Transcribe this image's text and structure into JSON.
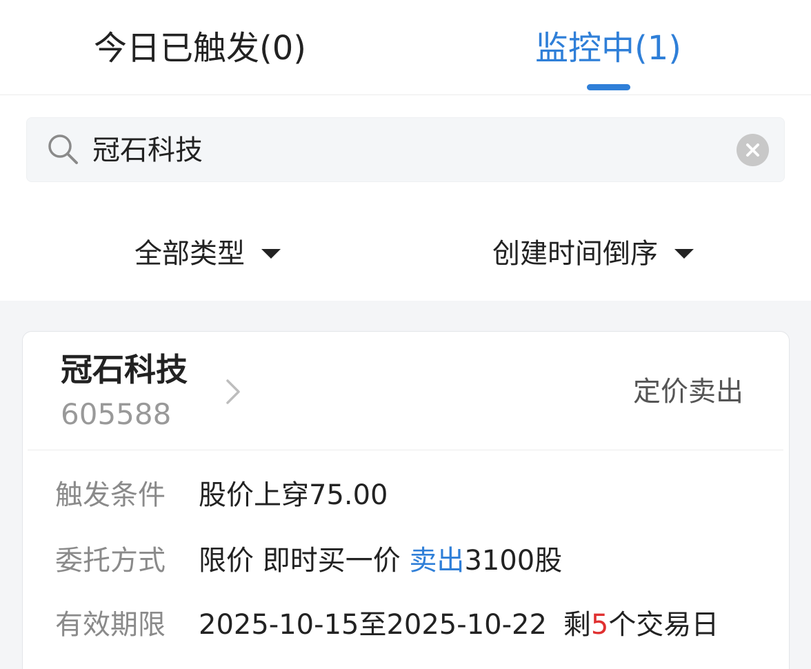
{
  "tabs": {
    "triggered_label": "今日已触发(0)",
    "monitoring_label": "监控中(1)"
  },
  "search": {
    "value": "冠石科技"
  },
  "filters": {
    "type_label": "全部类型",
    "sort_label": "创建时间倒序"
  },
  "card": {
    "stock_name": "冠石科技",
    "stock_code": "605588",
    "order_type": "定价卖出",
    "trigger": {
      "label": "触发条件",
      "value": "股价上穿75.00"
    },
    "entrust": {
      "label": "委托方式",
      "prefix": "限价 即时买一价 ",
      "action": "卖出",
      "quantity": "3100股"
    },
    "validity": {
      "label": "有效期限",
      "range": "2025-10-15至2025-10-22",
      "remaining_prefix": "剩",
      "remaining_days": "5",
      "remaining_suffix": "个交易日"
    }
  },
  "colors": {
    "accent": "#2f7fd8",
    "highlight": "#e03030"
  },
  "icons": [
    "search-icon",
    "clear-icon",
    "chevron-right-icon",
    "caret-down-icon"
  ]
}
